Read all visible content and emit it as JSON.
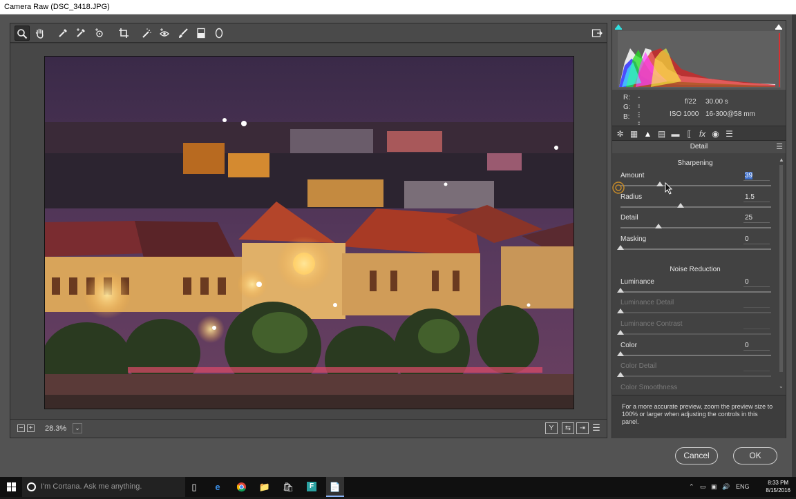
{
  "window": {
    "title": "Camera Raw (DSC_3418.JPG)"
  },
  "toolbar": {
    "tools": [
      "zoom-icon",
      "hand-icon",
      "white-balance-icon",
      "color-sampler-icon",
      "target-adjustment-icon",
      "crop-icon",
      "spot-removal-icon",
      "red-eye-icon",
      "adjustment-brush-icon",
      "graduated-filter-icon",
      "radial-filter-icon"
    ],
    "export_icon": "open-preferences-icon"
  },
  "preview": {
    "zoom_level": "28.3%"
  },
  "readout": {
    "r_label": "R:",
    "r_value": "---",
    "g_label": "G:",
    "g_value": "---",
    "b_label": "B:",
    "b_value": "---",
    "aperture": "f/22",
    "shutter": "30.00 s",
    "iso": "ISO 1000",
    "lens": "16-300@58 mm"
  },
  "panel": {
    "title": "Detail",
    "sharpening": {
      "title": "Sharpening",
      "amount_label": "Amount",
      "amount_value": "39",
      "amount_level": 0.26,
      "radius_label": "Radius",
      "radius_value": "1.5",
      "radius_level": 0.4,
      "detail_label": "Detail",
      "detail_value": "25",
      "detail_level": 0.25,
      "masking_label": "Masking",
      "masking_value": "0",
      "masking_level": 0
    },
    "noise_reduction": {
      "title": "Noise Reduction",
      "luminance_label": "Luminance",
      "luminance_value": "0",
      "luminance_detail_label": "Luminance Detail",
      "luminance_contrast_label": "Luminance Contrast",
      "color_label": "Color",
      "color_value": "0",
      "color_detail_label": "Color Detail",
      "color_smoothness_label": "Color Smoothness"
    },
    "hint": "For a more accurate preview, zoom the preview size to 100% or larger when adjusting the controls in this panel."
  },
  "buttons": {
    "cancel": "Cancel",
    "ok": "OK"
  },
  "taskbar": {
    "cortana_placeholder": "I'm Cortana. Ask me anything.",
    "language": "ENG",
    "time": "8:33 PM",
    "date": "8/15/2016"
  },
  "colors": {
    "accent_selection": "#3e6fc9",
    "dialog_bg": "#535353"
  }
}
